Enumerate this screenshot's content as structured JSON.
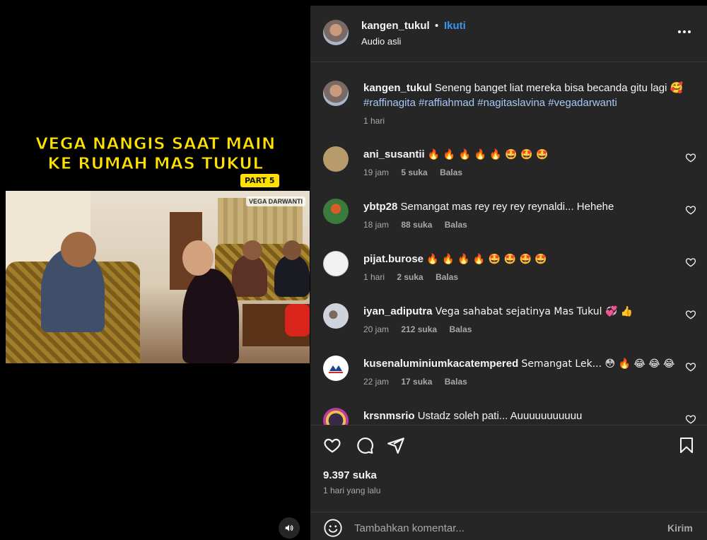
{
  "video": {
    "title_line1": "VEGA NANGIS SAAT MAIN",
    "title_line2": "KE RUMAH MAS TUKUL",
    "part_label": "PART 5",
    "watermark": "VEGA DARWANTI",
    "audio_icon": "speaker-icon"
  },
  "header": {
    "username": "kangen_tukul",
    "separator": "•",
    "follow_label": "Ikuti",
    "audio_label": "Audio asli",
    "more_icon": "more-horizontal-icon"
  },
  "caption": {
    "username": "kangen_tukul",
    "text": "Seneng banget liat mereka bisa becanda gitu lagi 🥰",
    "hashtags": "#raffinagita #raffiahmad #nagitaslavina #vegadarwanti",
    "time": "1 hari"
  },
  "comments": [
    {
      "username": "ani_susantii",
      "text": "🔥 🔥 🔥 🔥 🔥 🤩 🤩 🤩",
      "time": "19 jam",
      "likes": "5 suka",
      "reply": "Balas",
      "avatar_color": "#b79b6a"
    },
    {
      "username": "ybtp28",
      "text": "Semangat mas rey rey rey reynaldi... Hehehe",
      "time": "18 jam",
      "likes": "88 suka",
      "reply": "Balas",
      "avatar_color": "#3a7a3a"
    },
    {
      "username": "pijat.burose",
      "text": "🔥 🔥 🔥 🔥 🤩 🤩 🤩 🤩",
      "time": "1 hari",
      "likes": "2 suka",
      "reply": "Balas",
      "avatar_color": "#f2f2f2"
    },
    {
      "username": "iyan_adiputra",
      "text": "Vega sahabat sejatinya Mas Tukul 💞 👍",
      "time": "20 jam",
      "likes": "212 suka",
      "reply": "Balas",
      "avatar_color": "#cfd4dc"
    },
    {
      "username": "kusenaluminiumkacatempered",
      "text": "Semangat Lek... 😳 🔥 😂 😂 😂",
      "time": "22 jam",
      "likes": "17 suka",
      "reply": "Balas",
      "avatar_color": "#ffffff"
    },
    {
      "username": "krsnmsrio",
      "text": "Ustadz soleh pati... Auuuuuuuuuuu",
      "time": "",
      "likes": "",
      "reply": "",
      "avatar_color": "#e8c24a"
    }
  ],
  "actions": {
    "like_icon": "heart-icon",
    "comment_icon": "comment-icon",
    "share_icon": "send-icon",
    "save_icon": "bookmark-icon",
    "likes_count": "9.397 suka",
    "time_ago": "1 hari yang lalu"
  },
  "add_comment": {
    "emoji_icon": "smiley-icon",
    "placeholder": "Tambahkan komentar...",
    "post_label": "Kirim"
  },
  "colors": {
    "panel_bg": "#262626",
    "accent": "#3897f0",
    "hashtag": "#a8c7fa",
    "title_yellow": "#ffe100"
  }
}
